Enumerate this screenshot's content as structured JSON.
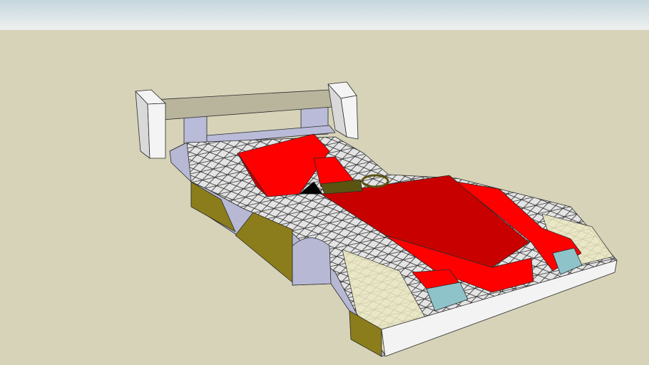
{
  "scene": {
    "colors": {
      "sky_top": "#c4d6dd",
      "sky_bottom": "#eef1ef",
      "ground": "#d6d3b9",
      "wing": "#b8b59c",
      "endplate": "#f4f4f4",
      "endplate_shade": "#d9d9d9",
      "strut": "#b9bbd8",
      "body_top": "#e4e4e4",
      "body_side": "#b7b8d4",
      "olive": "#8c7d1c",
      "cream": "#ebe8c0",
      "red": "#ff0000",
      "red_dark": "#c80000",
      "light": "#8fc3ca",
      "front": "#f3f3f3",
      "wheel": "#5a5410"
    }
  }
}
